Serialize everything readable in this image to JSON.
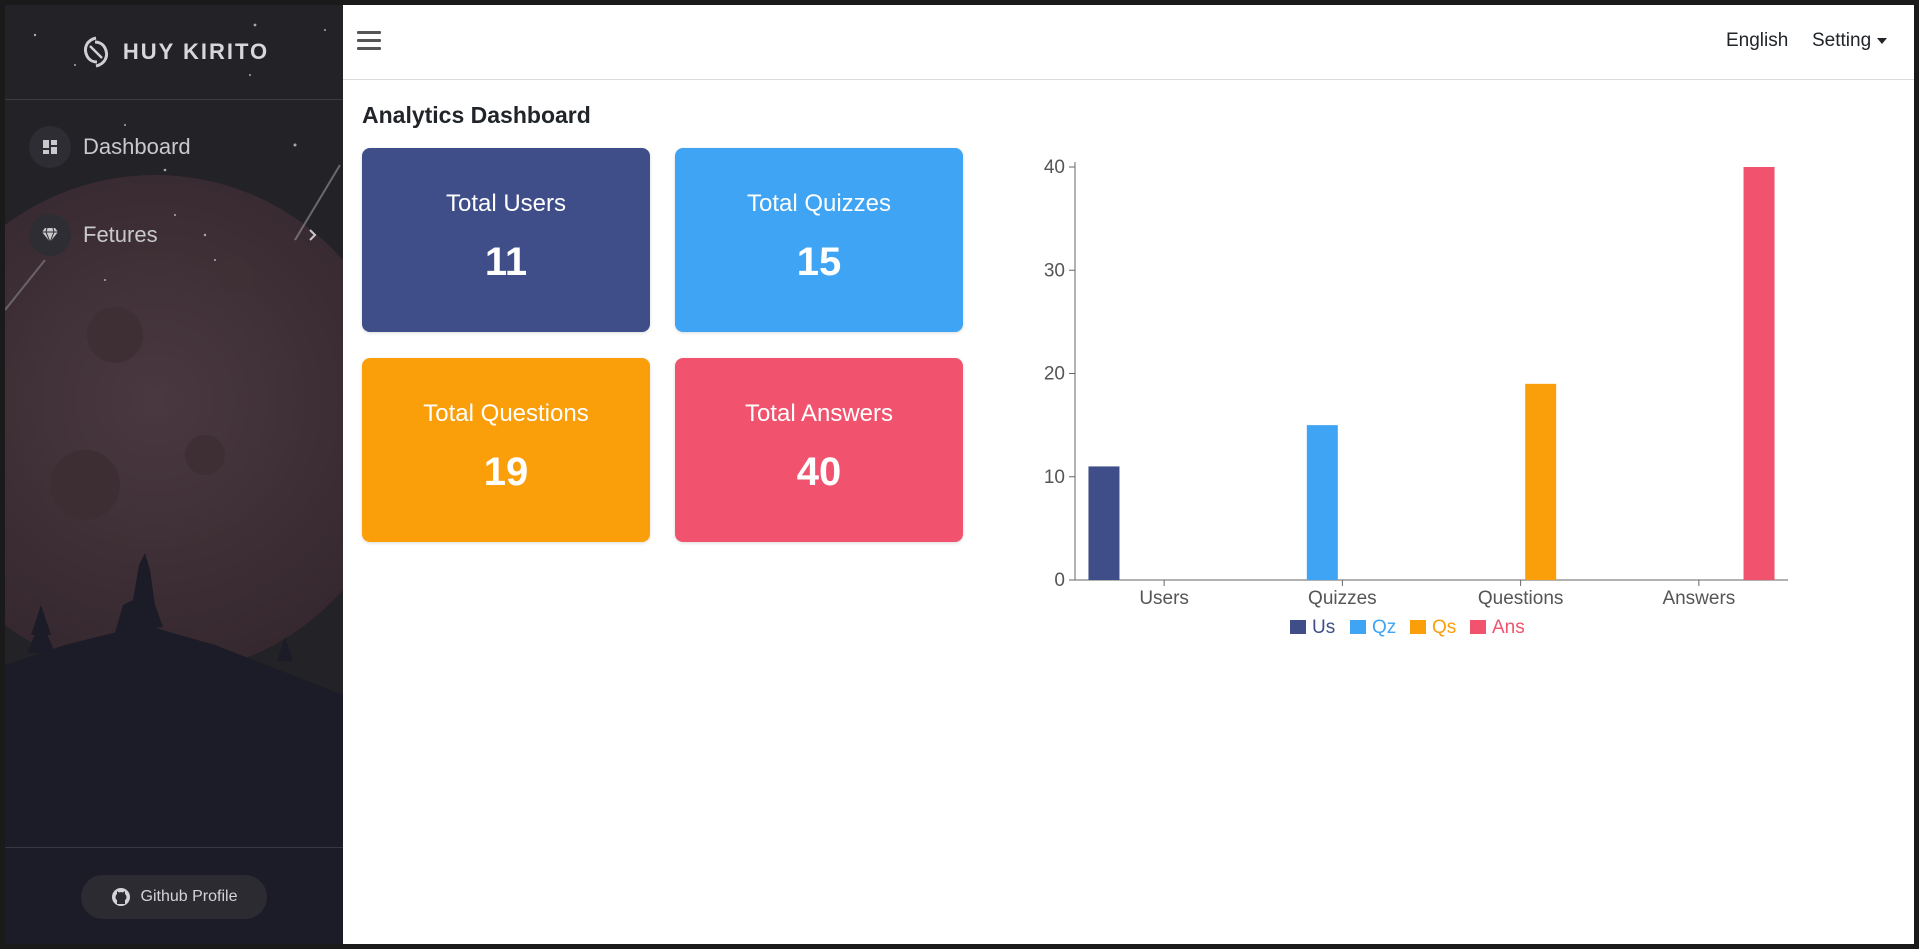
{
  "sidebar": {
    "brand": "HUY KIRITO",
    "items": [
      {
        "label": "Dashboard",
        "icon": "dashboard-icon"
      },
      {
        "label": "Fetures",
        "icon": "gem-icon"
      }
    ],
    "footer_button": "Github Profile"
  },
  "header": {
    "language": "English",
    "setting": "Setting"
  },
  "main": {
    "title": "Analytics Dashboard",
    "cards": [
      {
        "title": "Total Users",
        "value": "11",
        "color": "#3f4e89"
      },
      {
        "title": "Total Quizzes",
        "value": "15",
        "color": "#3ea4f3"
      },
      {
        "title": "Total Questions",
        "value": "19",
        "color": "#fa9e0a"
      },
      {
        "title": "Total Answers",
        "value": "40",
        "color": "#f1536e"
      }
    ]
  },
  "chart_data": {
    "type": "bar",
    "categories": [
      "Users",
      "Quizzes",
      "Questions",
      "Answers"
    ],
    "series": [
      {
        "name": "Us",
        "values": [
          11,
          0,
          0,
          0
        ],
        "color": "#3f4e89"
      },
      {
        "name": "Qz",
        "values": [
          0,
          15,
          0,
          0
        ],
        "color": "#3ea4f3"
      },
      {
        "name": "Qs",
        "values": [
          0,
          0,
          19,
          0
        ],
        "color": "#fa9e0a"
      },
      {
        "name": "Ans",
        "values": [
          0,
          0,
          0,
          40
        ],
        "color": "#f1536e"
      }
    ],
    "yticks": [
      0,
      10,
      20,
      30,
      40
    ],
    "ylim": [
      0,
      40
    ],
    "legend": "bottom",
    "grid": false
  }
}
